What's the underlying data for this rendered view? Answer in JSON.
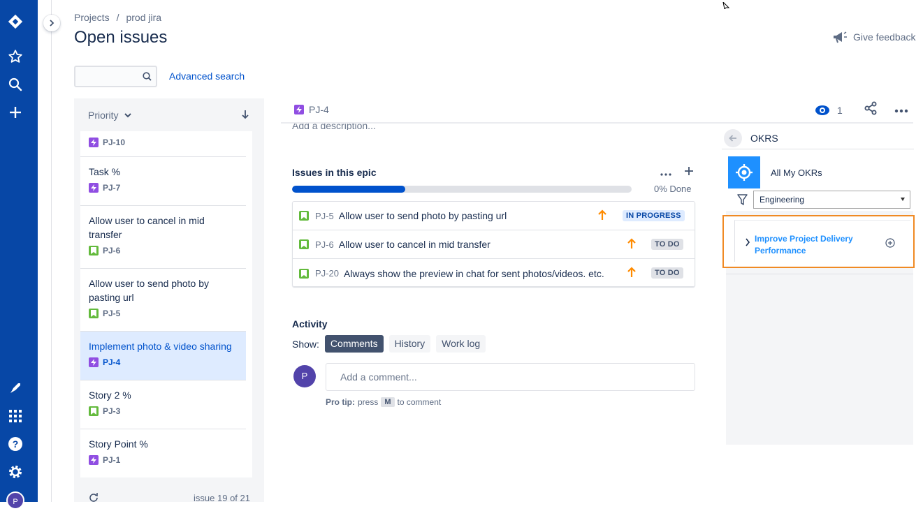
{
  "breadcrumb": {
    "projects": "Projects",
    "separator": "/",
    "project": "prod jira"
  },
  "page_title": "Open issues",
  "give_feedback": "Give feedback",
  "search": {
    "placeholder": "",
    "advanced": "Advanced search"
  },
  "list": {
    "sort_label": "Priority",
    "issues": [
      {
        "title": "",
        "key": "PJ-10",
        "type": "epic"
      },
      {
        "title": "Task %",
        "key": "PJ-7",
        "type": "epic"
      },
      {
        "title": "Allow user to cancel in mid transfer",
        "key": "PJ-6",
        "type": "story"
      },
      {
        "title": "Allow user to send photo by pasting url",
        "key": "PJ-5",
        "type": "story"
      },
      {
        "title": "Implement photo & video sharing",
        "key": "PJ-4",
        "type": "epic",
        "selected": true
      },
      {
        "title": "Story 2 %",
        "key": "PJ-3",
        "type": "story"
      },
      {
        "title": "Story Point %",
        "key": "PJ-1",
        "type": "epic"
      }
    ],
    "footer": "issue 19 of 21"
  },
  "issue": {
    "key": "PJ-4",
    "watchers": "1",
    "description_placeholder": "Add a description...",
    "epic": {
      "title": "Issues in this epic",
      "progress_pct": 0,
      "progress_label": "0% Done",
      "children": [
        {
          "key": "PJ-5",
          "summary": "Allow user to send photo by pasting url",
          "status": "IN PROGRESS",
          "status_kind": "inprog"
        },
        {
          "key": "PJ-6",
          "summary": "Allow user to cancel in mid transfer",
          "status": "TO DO",
          "status_kind": "todo"
        },
        {
          "key": "PJ-20",
          "summary": "Always show the preview in chat for sent photos/videos. etc.",
          "status": "TO DO",
          "status_kind": "todo"
        }
      ]
    },
    "activity": {
      "title": "Activity",
      "show_label": "Show:",
      "tabs": [
        "Comments",
        "History",
        "Work log"
      ],
      "active_tab": "Comments",
      "avatar_initial": "P",
      "comment_placeholder": "Add a comment...",
      "protip_bold": "Pro tip:",
      "protip_press": "press",
      "protip_key": "M",
      "protip_rest": "to comment"
    }
  },
  "okrs": {
    "header": "OKRS",
    "title": "All My OKRs",
    "filter_value": "Engineering",
    "objective": "Improve Project Delivery Performance"
  },
  "user_avatar": "P",
  "colors": {
    "nav": "#0747a6",
    "accent": "#0052cc",
    "highlight": "#f08a24",
    "okr_blue": "#1e90ff"
  }
}
